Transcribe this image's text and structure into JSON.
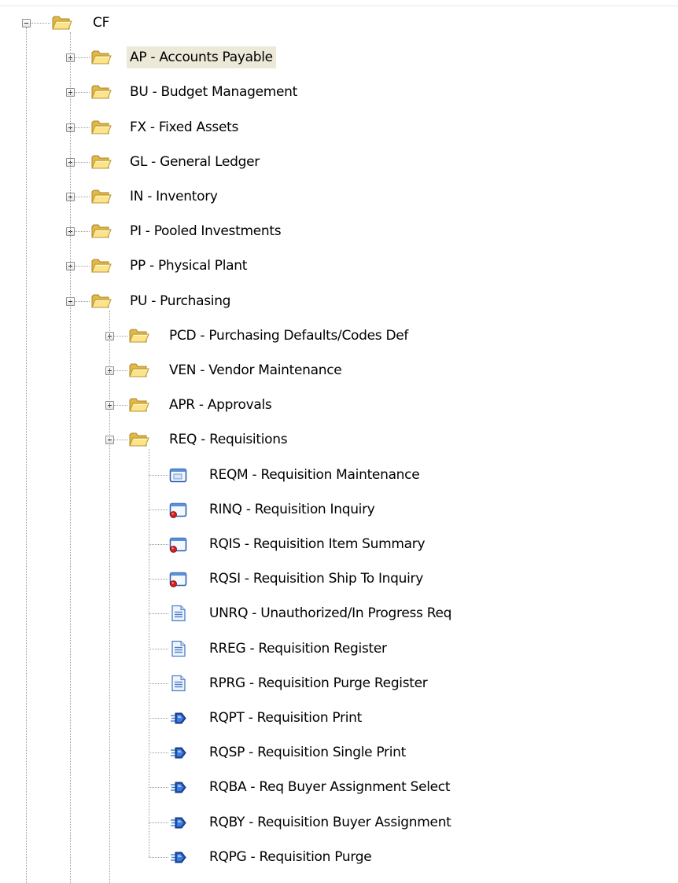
{
  "tree": {
    "root": {
      "label": "CF",
      "expanded": true
    },
    "modules": [
      {
        "label": "AP - Accounts Payable",
        "expanded": false,
        "selected": true
      },
      {
        "label": "BU - Budget Management",
        "expanded": false
      },
      {
        "label": "FX - Fixed Assets",
        "expanded": false
      },
      {
        "label": "GL - General Ledger",
        "expanded": false
      },
      {
        "label": "IN - Inventory",
        "expanded": false
      },
      {
        "label": "PI - Pooled Investments",
        "expanded": false
      },
      {
        "label": "PP - Physical Plant",
        "expanded": false
      },
      {
        "label": "PU - Purchasing",
        "expanded": true
      }
    ],
    "purchasing_children": [
      {
        "label": "PCD - Purchasing Defaults/Codes Def",
        "expanded": false
      },
      {
        "label": "VEN - Vendor Maintenance",
        "expanded": false
      },
      {
        "label": "APR - Approvals",
        "expanded": false
      },
      {
        "label": "REQ - Requisitions",
        "expanded": true
      }
    ],
    "requisition_items": [
      {
        "label": "REQM - Requisition Maintenance",
        "icon": "form-icon"
      },
      {
        "label": "RINQ - Requisition Inquiry",
        "icon": "inquiry-form-icon"
      },
      {
        "label": "RQIS - Requisition Item Summary",
        "icon": "inquiry-form-icon"
      },
      {
        "label": "RQSI - Requisition Ship To Inquiry",
        "icon": "inquiry-form-icon"
      },
      {
        "label": "UNRQ - Unauthorized/In Progress Req",
        "icon": "report-icon"
      },
      {
        "label": "RREG - Requisition Register",
        "icon": "report-icon"
      },
      {
        "label": "RPRG - Requisition Purge Register",
        "icon": "report-icon"
      },
      {
        "label": "RQPT - Requisition Print",
        "icon": "process-icon"
      },
      {
        "label": "RQSP - Requisition Single Print",
        "icon": "process-icon"
      },
      {
        "label": "RQBA - Req Buyer Assignment Select",
        "icon": "process-icon"
      },
      {
        "label": "RQBY - Requisition Buyer Assignment",
        "icon": "process-icon"
      },
      {
        "label": "RQPG - Requisition Purge",
        "icon": "process-icon"
      }
    ]
  }
}
